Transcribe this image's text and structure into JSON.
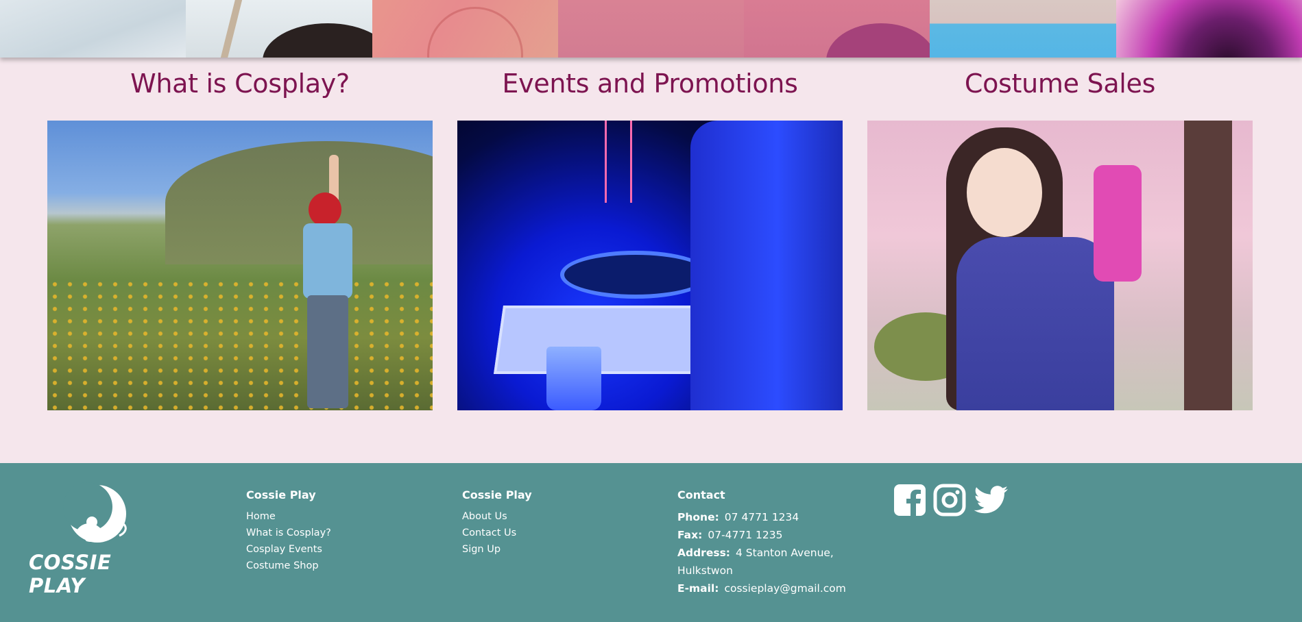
{
  "banner": {
    "tiles": [
      "banner-tile-1",
      "banner-tile-2",
      "banner-tile-3",
      "banner-tile-4",
      "banner-tile-5",
      "banner-tile-6",
      "banner-tile-7"
    ]
  },
  "sections": [
    {
      "title": "What is Cosplay?"
    },
    {
      "title": "Events and Promotions"
    },
    {
      "title": "Costume Sales"
    }
  ],
  "footer": {
    "logo_text": "COSSIE PLAY",
    "col1": {
      "heading": "Cossie Play",
      "links": [
        "Home",
        "What is Cosplay?",
        "Cosplay Events",
        "Costume Shop"
      ]
    },
    "col2": {
      "heading": "Cossie Play",
      "links": [
        "About Us",
        "Contact Us",
        "Sign Up"
      ]
    },
    "contact": {
      "heading": "Contact",
      "phone_label": "Phone:",
      "phone": "07 4771 1234",
      "fax_label": "Fax:",
      "fax": "07-4771 1235",
      "address_label": "Address:",
      "address_line1": "4 Stanton Avenue,",
      "address_line2": "Hulkstwon",
      "email_label": "E-mail:",
      "email": "cossieplay@gmail.com"
    },
    "social": [
      "facebook-icon",
      "instagram-icon",
      "twitter-icon"
    ]
  },
  "colors": {
    "page_bg": "#f5e6ec",
    "heading": "#7d1450",
    "footer_bg": "#559292",
    "footer_text": "#ffffff"
  }
}
